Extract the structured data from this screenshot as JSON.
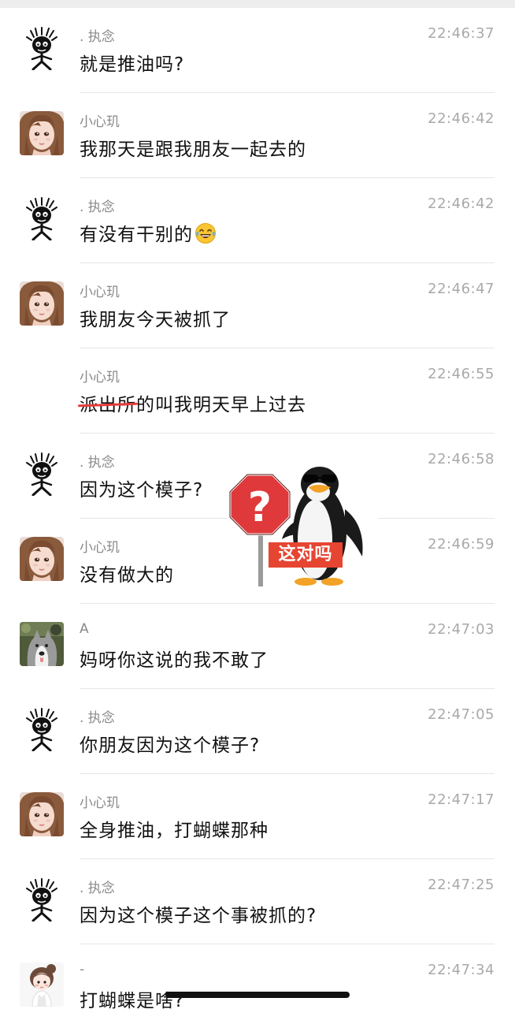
{
  "messages": [
    {
      "sender": ". 执念",
      "time": "22:46:37",
      "text": "就是推油吗?"
    },
    {
      "sender": "小心玑",
      "time": "22:46:42",
      "text": "我那天是跟我朋友一起去的"
    },
    {
      "sender": ". 执念",
      "time": "22:46:42",
      "text": "有没有干别的"
    },
    {
      "sender": "小心玑",
      "time": "22:46:47",
      "text": "我朋友今天被抓了"
    },
    {
      "sender": "小心玑",
      "time": "22:46:55",
      "text_struck": "派出所",
      "text_rest": "的叫我明天早上过去"
    },
    {
      "sender": ". 执念",
      "time": "22:46:58",
      "text": "因为这个模子?"
    },
    {
      "sender": "小心玑",
      "time": "22:46:59",
      "text": "没有做大的"
    },
    {
      "sender": "A",
      "time": "22:47:03",
      "text": "妈呀你这说的我不敢了"
    },
    {
      "sender": ". 执念",
      "time": "22:47:05",
      "text": "你朋友因为这个模子?"
    },
    {
      "sender": "小心玑",
      "time": "22:47:17",
      "text": "全身推油，打蝴蝶那种"
    },
    {
      "sender": ". 执念",
      "time": "22:47:25",
      "text": "因为这个模子这个事被抓的?"
    },
    {
      "sender": "-",
      "time": "22:47:34",
      "text": "打蝴蝶是啥?"
    }
  ],
  "sticker": {
    "label": "这对吗",
    "sign_symbol": "?"
  },
  "emoji": "laughing-tears-emoji",
  "colors": {
    "strike": "#e53b3b",
    "sticker_label_bg": "#e64532",
    "sign_red": "#e0393b"
  }
}
